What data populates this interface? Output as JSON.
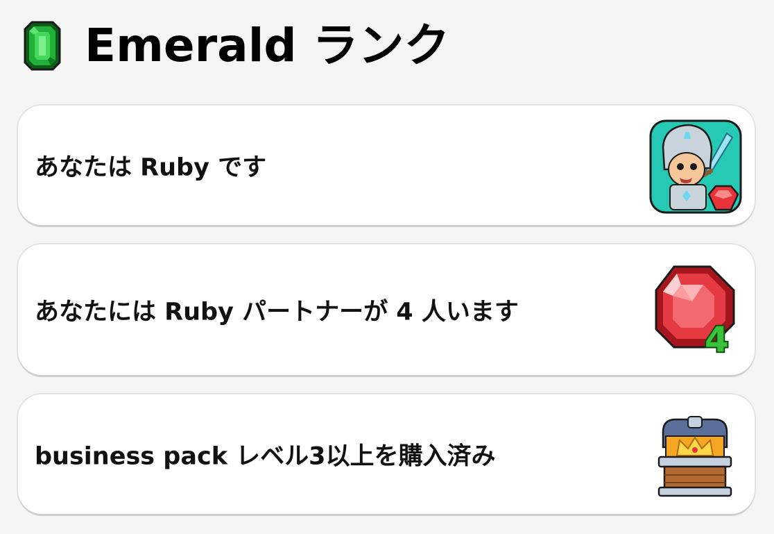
{
  "header": {
    "title": "Emerald ランク",
    "icon": "emerald-gem-icon"
  },
  "requirements": [
    {
      "label": "あなたは Ruby です",
      "icon": "knight-with-ruby-icon"
    },
    {
      "label": "あなたには Ruby パートナーが 4 人います",
      "icon": "ruby-gem-count-icon",
      "badge": "4"
    },
    {
      "label": "business pack レベル3以上を購入済み",
      "icon": "treasure-chest-crown-icon"
    }
  ],
  "colors": {
    "emerald": "#1f9e2a",
    "ruby": "#e8333a",
    "badge_green": "#39c23a",
    "teal_bg": "#26c9b3",
    "background": "#f5f5f5"
  }
}
